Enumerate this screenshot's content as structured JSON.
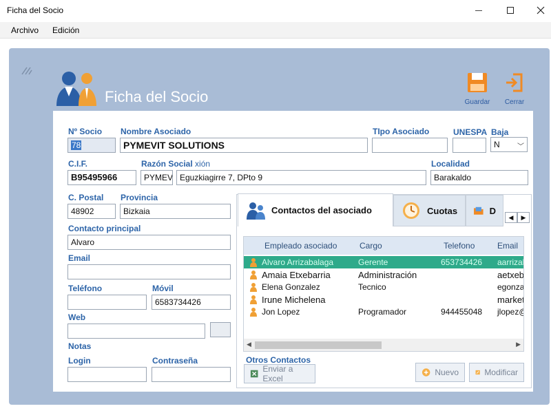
{
  "window": {
    "title": "Ficha del Socio"
  },
  "menu": {
    "items": [
      "Archivo",
      "Edición"
    ]
  },
  "header": {
    "title": "Ficha del Socio"
  },
  "toolbar": {
    "save_label": "Guardar",
    "close_label": "Cerrar"
  },
  "form": {
    "num_socio": {
      "label": "Nº Socio",
      "value": "78"
    },
    "nombre": {
      "label": "Nombre Asociado",
      "value": "PYMEVIT SOLUTIONS"
    },
    "tipo": {
      "label": "TIpo Asociado",
      "value": ""
    },
    "unespa": {
      "label": "UNESPA",
      "value": ""
    },
    "baja": {
      "label": "Baja",
      "value": "N"
    },
    "cif": {
      "label": "C.I.F.",
      "value": "B95495966"
    },
    "razon": {
      "label": "Razón Social",
      "label_suffix": "xión",
      "value": "PYMEV"
    },
    "direccion": {
      "value": "Eguzkiagirre 7, DPto 9"
    },
    "localidad": {
      "label": "Localidad",
      "value": "Barakaldo"
    },
    "cpostal": {
      "label": "C. Postal",
      "value": "48902"
    },
    "provincia": {
      "label": "Provincia",
      "value": "Bizkaia"
    },
    "contacto": {
      "label": "Contacto principal",
      "value": "Alvaro"
    },
    "email": {
      "label": "Email",
      "value": ""
    },
    "telefono": {
      "label": "Teléfono",
      "value": ""
    },
    "movil": {
      "label": "Móvil",
      "value": "6583734426"
    },
    "web": {
      "label": "Web",
      "value": ""
    },
    "notas": {
      "label": "Notas"
    },
    "login": {
      "label": "Login",
      "value": ""
    },
    "contrasena": {
      "label": "Contraseña",
      "value": ""
    }
  },
  "tabs": [
    {
      "label": "Contactos del asociado",
      "icon": "people-icon"
    },
    {
      "label": "Cuotas",
      "icon": "clock-icon"
    },
    {
      "label": "D",
      "icon": "folder-icon"
    }
  ],
  "contacts": {
    "columns": [
      "Empleado asociado",
      "Cargo",
      "Telefono",
      "Email"
    ],
    "rows": [
      {
        "empleado": "Alvaro Arrizabalaga",
        "cargo": "Gerente",
        "telefono": "653734426",
        "email": "aarrizab"
      },
      {
        "empleado": "Amaia Etxebarria",
        "cargo": "Administración",
        "telefono": "",
        "email": "aetxeb"
      },
      {
        "empleado": "Elena Gonzalez",
        "cargo": "Tecnico",
        "telefono": "",
        "email": "egonza"
      },
      {
        "empleado": "Irune Michelena",
        "cargo": "",
        "telefono": "",
        "email": "market"
      },
      {
        "empleado": "Jon Lopez",
        "cargo": "Programador",
        "telefono": "944455048",
        "email": "jlopez@"
      }
    ]
  },
  "otros": {
    "label": "Otros Contactos",
    "excel_label": "Enviar a Excel",
    "nuevo_label": "Nuevo",
    "modificar_label": "Modificar"
  }
}
